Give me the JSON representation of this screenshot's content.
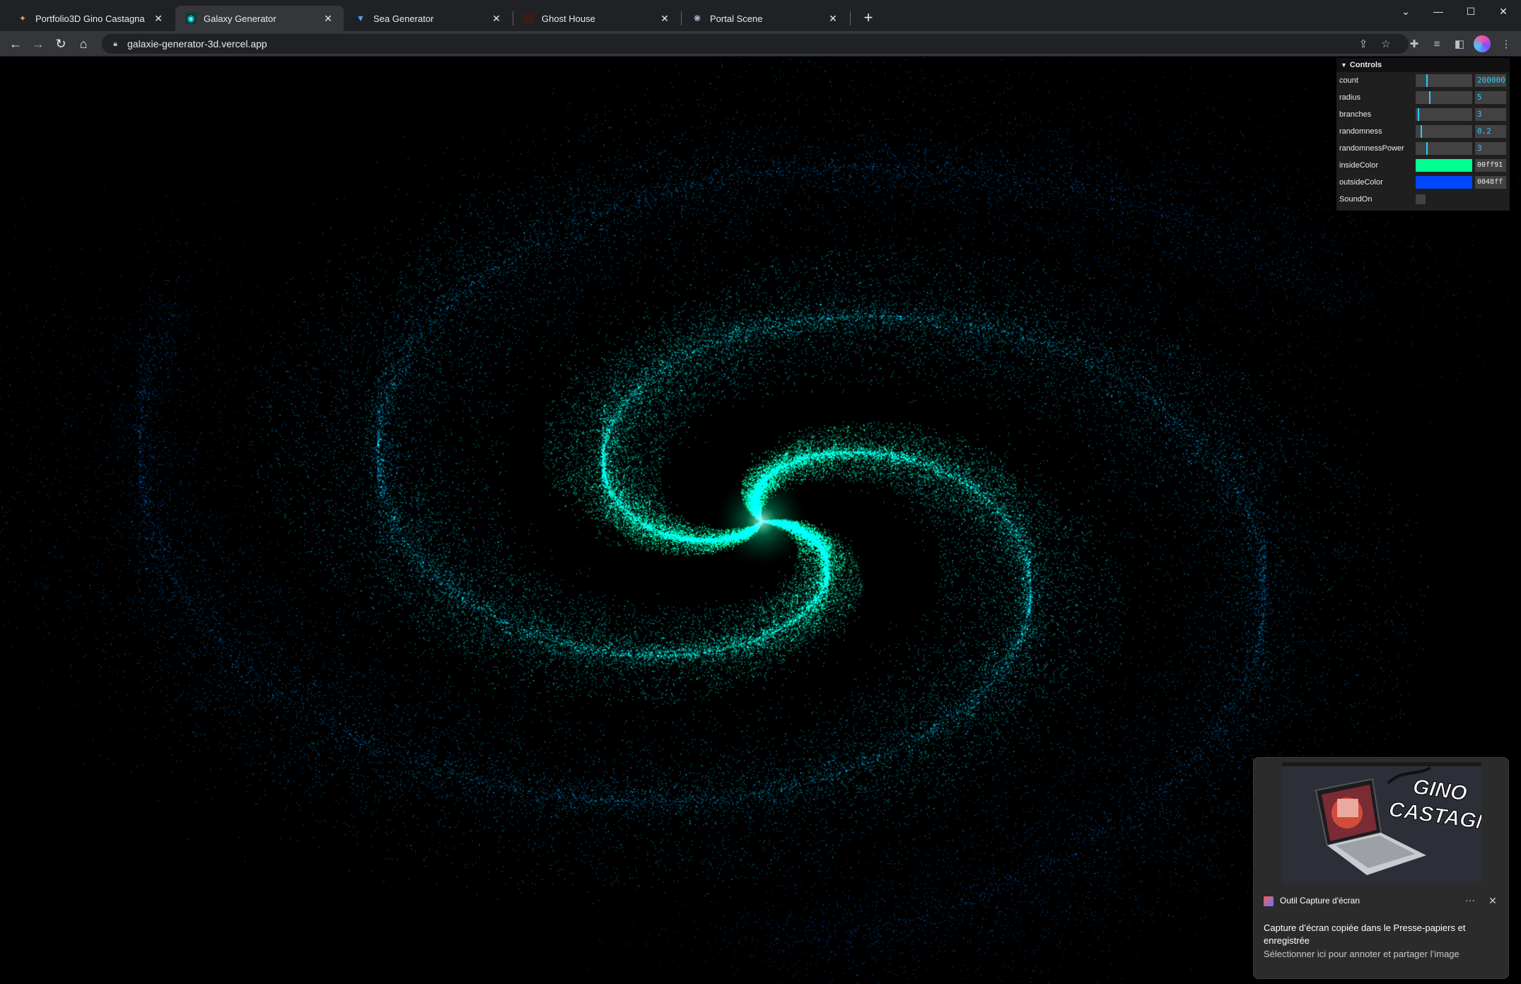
{
  "browser": {
    "tabs": [
      {
        "title": "Portfolio3D Gino Castagna",
        "icon": "portfolio-favicon",
        "active": false
      },
      {
        "title": "Galaxy Generator",
        "icon": "galaxy-favicon",
        "active": true
      },
      {
        "title": "Sea Generator",
        "icon": "sea-favicon",
        "active": false
      },
      {
        "title": "Ghost House",
        "icon": "ghost-house-favicon",
        "active": false
      },
      {
        "title": "Portal Scene",
        "icon": "portal-favicon",
        "active": false
      }
    ],
    "url": "galaxie-generator-3d.vercel.app"
  },
  "gui": {
    "title": "Controls",
    "rows": [
      {
        "label": "count",
        "value": "200000",
        "fraction": 0.2
      },
      {
        "label": "radius",
        "value": "5",
        "fraction": 0.25
      },
      {
        "label": "branches",
        "value": "3",
        "fraction": 0.05
      },
      {
        "label": "randomness",
        "value": "0.2",
        "fraction": 0.1
      },
      {
        "label": "randomnessPower",
        "value": "3",
        "fraction": 0.2
      }
    ],
    "colors": [
      {
        "label": "insideColor",
        "hex": "00ff91",
        "color": "#00ff91"
      },
      {
        "label": "outsideColor",
        "hex": "0048ff",
        "color": "#0048ff"
      }
    ],
    "checkbox": {
      "label": "SoundOn",
      "checked": false
    },
    "accent": "#2cc9ff"
  },
  "toast": {
    "app_name": "Outil Capture d'écran",
    "message": "Capture d’écran copiée dans le Presse-papiers et enregistrée",
    "sub": "Sélectionner ici pour annoter et partager l’image",
    "preview_text_line1": "GINO",
    "preview_text_line2": "CASTAGNA"
  },
  "galaxy": {
    "inside_color": "#00ff91",
    "outside_color": "#0048ff",
    "branches": 3,
    "radius": 5,
    "randomness": 0.2,
    "randomness_power": 3
  }
}
